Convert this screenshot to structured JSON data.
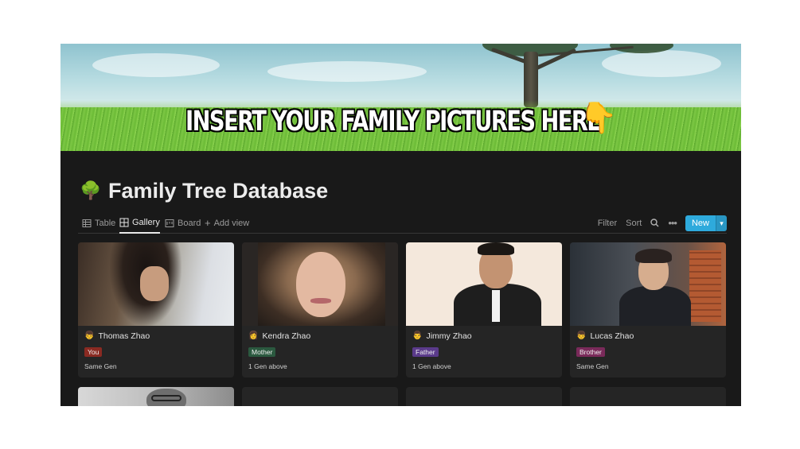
{
  "banner": {
    "text": "INSERT YOUR FAMILY PICTURES HERE",
    "pointer_emoji": "👇"
  },
  "page": {
    "icon": "🌳",
    "title": "Family Tree Database"
  },
  "views": {
    "tabs": [
      {
        "label": "Table",
        "icon": "table-icon"
      },
      {
        "label": "Gallery",
        "icon": "gallery-icon",
        "active": true
      },
      {
        "label": "Board",
        "icon": "board-icon"
      },
      {
        "label": "Add view",
        "icon": "plus-icon"
      }
    ],
    "filter_label": "Filter",
    "sort_label": "Sort",
    "search_icon": "search-icon",
    "more_icon": "more-icon",
    "new_label": "New"
  },
  "cards": [
    {
      "name": "Thomas Zhao",
      "avatar": "👦",
      "relation": "You",
      "relation_color": "#8a2a22",
      "generation": "Same Gen"
    },
    {
      "name": "Kendra Zhao",
      "avatar": "👩",
      "relation": "Mother",
      "relation_color": "#2b593f",
      "generation": "1 Gen above"
    },
    {
      "name": "Jimmy Zhao",
      "avatar": "👨",
      "relation": "Father",
      "relation_color": "#5a3a8a",
      "generation": "1 Gen above"
    },
    {
      "name": "Lucas Zhao",
      "avatar": "👦",
      "relation": "Brother",
      "relation_color": "#7a2a5a",
      "generation": "Same Gen"
    }
  ],
  "colors": {
    "background": "#191919",
    "card": "#252525",
    "accent": "#2eaadc"
  }
}
